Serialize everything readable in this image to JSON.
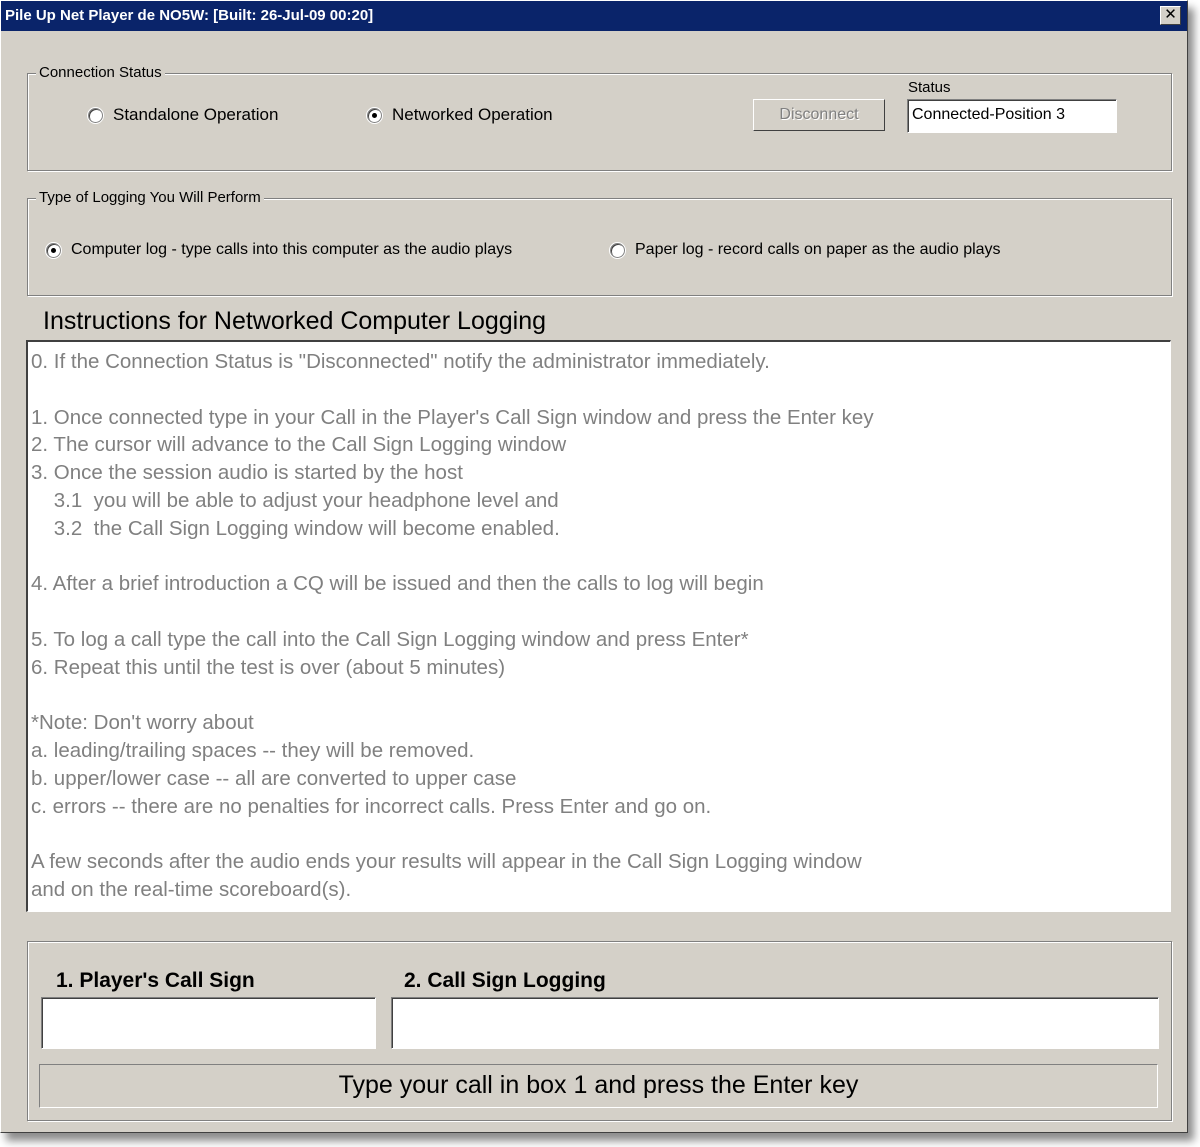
{
  "window": {
    "title": "Pile Up Net Player de NO5W:  [Built: 26-Jul-09 00:20]",
    "close_glyph": "✕"
  },
  "connection": {
    "legend": "Connection Status",
    "standalone_label": "Standalone Operation",
    "networked_label": "Networked Operation",
    "selected": "networked",
    "disconnect_label": "Disconnect",
    "status_label": "Status",
    "status_value": "Connected-Position 3"
  },
  "logging_type": {
    "legend": "Type of Logging You Will Perform",
    "computer_label": "Computer log - type calls into this computer as the audio plays",
    "paper_label": "Paper log - record calls on paper as the audio plays",
    "selected": "computer"
  },
  "instructions": {
    "heading": "Instructions for Networked Computer Logging",
    "lines": [
      "0. If the Connection Status is \"Disconnected\" notify the administrator immediately.",
      "",
      "1. Once connected type in your Call in the Player's Call Sign window and press the Enter key",
      "2. The cursor will advance to the Call Sign Logging window",
      "3. Once the session audio is started by the host",
      "    3.1  you will be able to adjust your headphone level and",
      "    3.2  the Call Sign Logging window will become enabled.",
      "",
      "4. After a brief introduction a CQ will be issued and then the calls to log will begin",
      "",
      "5. To log a call type the call into the Call Sign Logging window and press Enter*",
      "6. Repeat this until the test is over (about 5 minutes)",
      "",
      "*Note: Don't worry about",
      "a. leading/trailing spaces -- they will be removed.",
      "b. upper/lower case -- all are converted to upper case",
      "c. errors -- there are no penalties for incorrect calls. Press Enter and go on.",
      "",
      "A few seconds after the audio ends your results will appear in the Call Sign Logging window",
      "and on the real-time scoreboard(s)."
    ]
  },
  "fields": {
    "player_call_label": "1. Player's Call Sign",
    "player_call_value": "",
    "logging_label": "2. Call Sign Logging",
    "logging_value": ""
  },
  "status_message": "Type your call in box 1 and press the Enter key",
  "colors": {
    "title_bar": "#0a246a",
    "window_face": "#d4d0c8",
    "instruction_text": "#808080"
  }
}
